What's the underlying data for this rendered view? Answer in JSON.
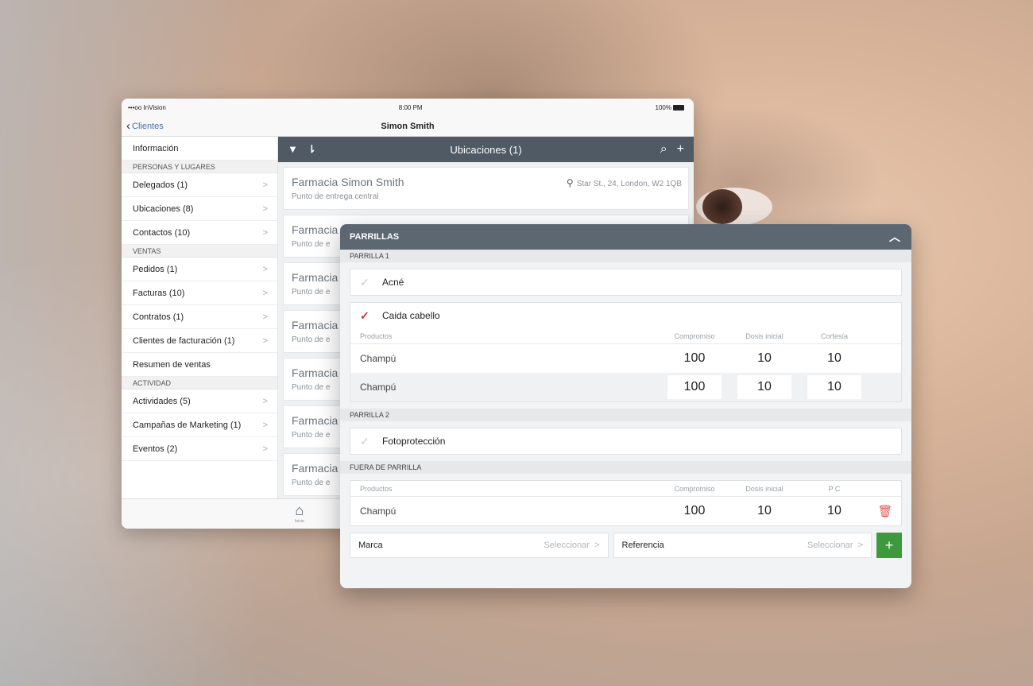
{
  "statusbar": {
    "carrier": "•••oo InVision",
    "time": "8:00 PM",
    "battery": "100%"
  },
  "navbar": {
    "back": "Clientes",
    "title": "Simon Smith"
  },
  "sidebar": {
    "info": "Información",
    "sections": [
      {
        "title": "PERSONAS Y LUGARES",
        "items": [
          "Delegados (1)",
          "Ubicaciones (8)",
          "Contactos (10)"
        ]
      },
      {
        "title": "VENTAS",
        "items": [
          "Pedidos (1)",
          "Facturas (10)",
          "Contratos (1)",
          "Clientes de facturación (1)",
          "Resumen de ventas"
        ]
      },
      {
        "title": "ACTIVIDAD",
        "items": [
          "Actividades (5)",
          "Campañas de Marketing (1)",
          "Eventos (2)"
        ]
      }
    ]
  },
  "main": {
    "title": "Ubicaciones (1)",
    "cards": [
      {
        "name": "Farmacia Simon Smith",
        "sub": "Punto de entrega central",
        "addr": "Star St., 24, London, W2 1QB"
      },
      {
        "name": "Farmacia S",
        "sub": "Punto de e"
      },
      {
        "name": "Farmacia",
        "sub": "Punto de e"
      },
      {
        "name": "Farmacia",
        "sub": "Punto de e"
      },
      {
        "name": "Farmacia",
        "sub": "Punto de e"
      },
      {
        "name": "Farmacia",
        "sub": "Punto de e"
      },
      {
        "name": "Farmacia",
        "sub": "Punto de e"
      }
    ],
    "tab_home": "Inicio"
  },
  "panel": {
    "title": "PARRILLAS",
    "parrilla1": {
      "label": "PARRILLA 1",
      "item1": "Acné",
      "item2": "Caida cabello",
      "headers": [
        "Productos",
        "Compromiso",
        "Dosis inicial",
        "Cortesía"
      ],
      "rows": [
        {
          "product": "Champú",
          "v1": "100",
          "v2": "10",
          "v3": "10"
        },
        {
          "product": "Champú",
          "v1": "100",
          "v2": "10",
          "v3": "10"
        }
      ]
    },
    "parrilla2": {
      "label": "PARRILLA 2",
      "item": "Fotoprotección"
    },
    "fuera": {
      "label": "FUERA DE PARRILLA",
      "headers": [
        "Productos",
        "Compromiso",
        "Dosis inicial",
        "P C"
      ],
      "row": {
        "product": "Champú",
        "v1": "100",
        "v2": "10",
        "v3": "10"
      }
    },
    "marca": {
      "label": "Marca",
      "hint": "Seleccionar"
    },
    "referencia": {
      "label": "Referencia",
      "hint": "Seleccionar"
    },
    "add": "+"
  },
  "colors": {
    "toolbar": "#4f5a64",
    "panel_header": "#5d6772",
    "check_on": "#d0312d",
    "add_button": "#3c9a3c",
    "trash": "#e05a55"
  },
  "icons": [
    "filter-icon",
    "sort-icon",
    "search-icon",
    "plus-icon",
    "pin-icon",
    "home-icon",
    "chevron-up-icon",
    "check-icon",
    "trash-icon",
    "chevron-right-icon"
  ]
}
